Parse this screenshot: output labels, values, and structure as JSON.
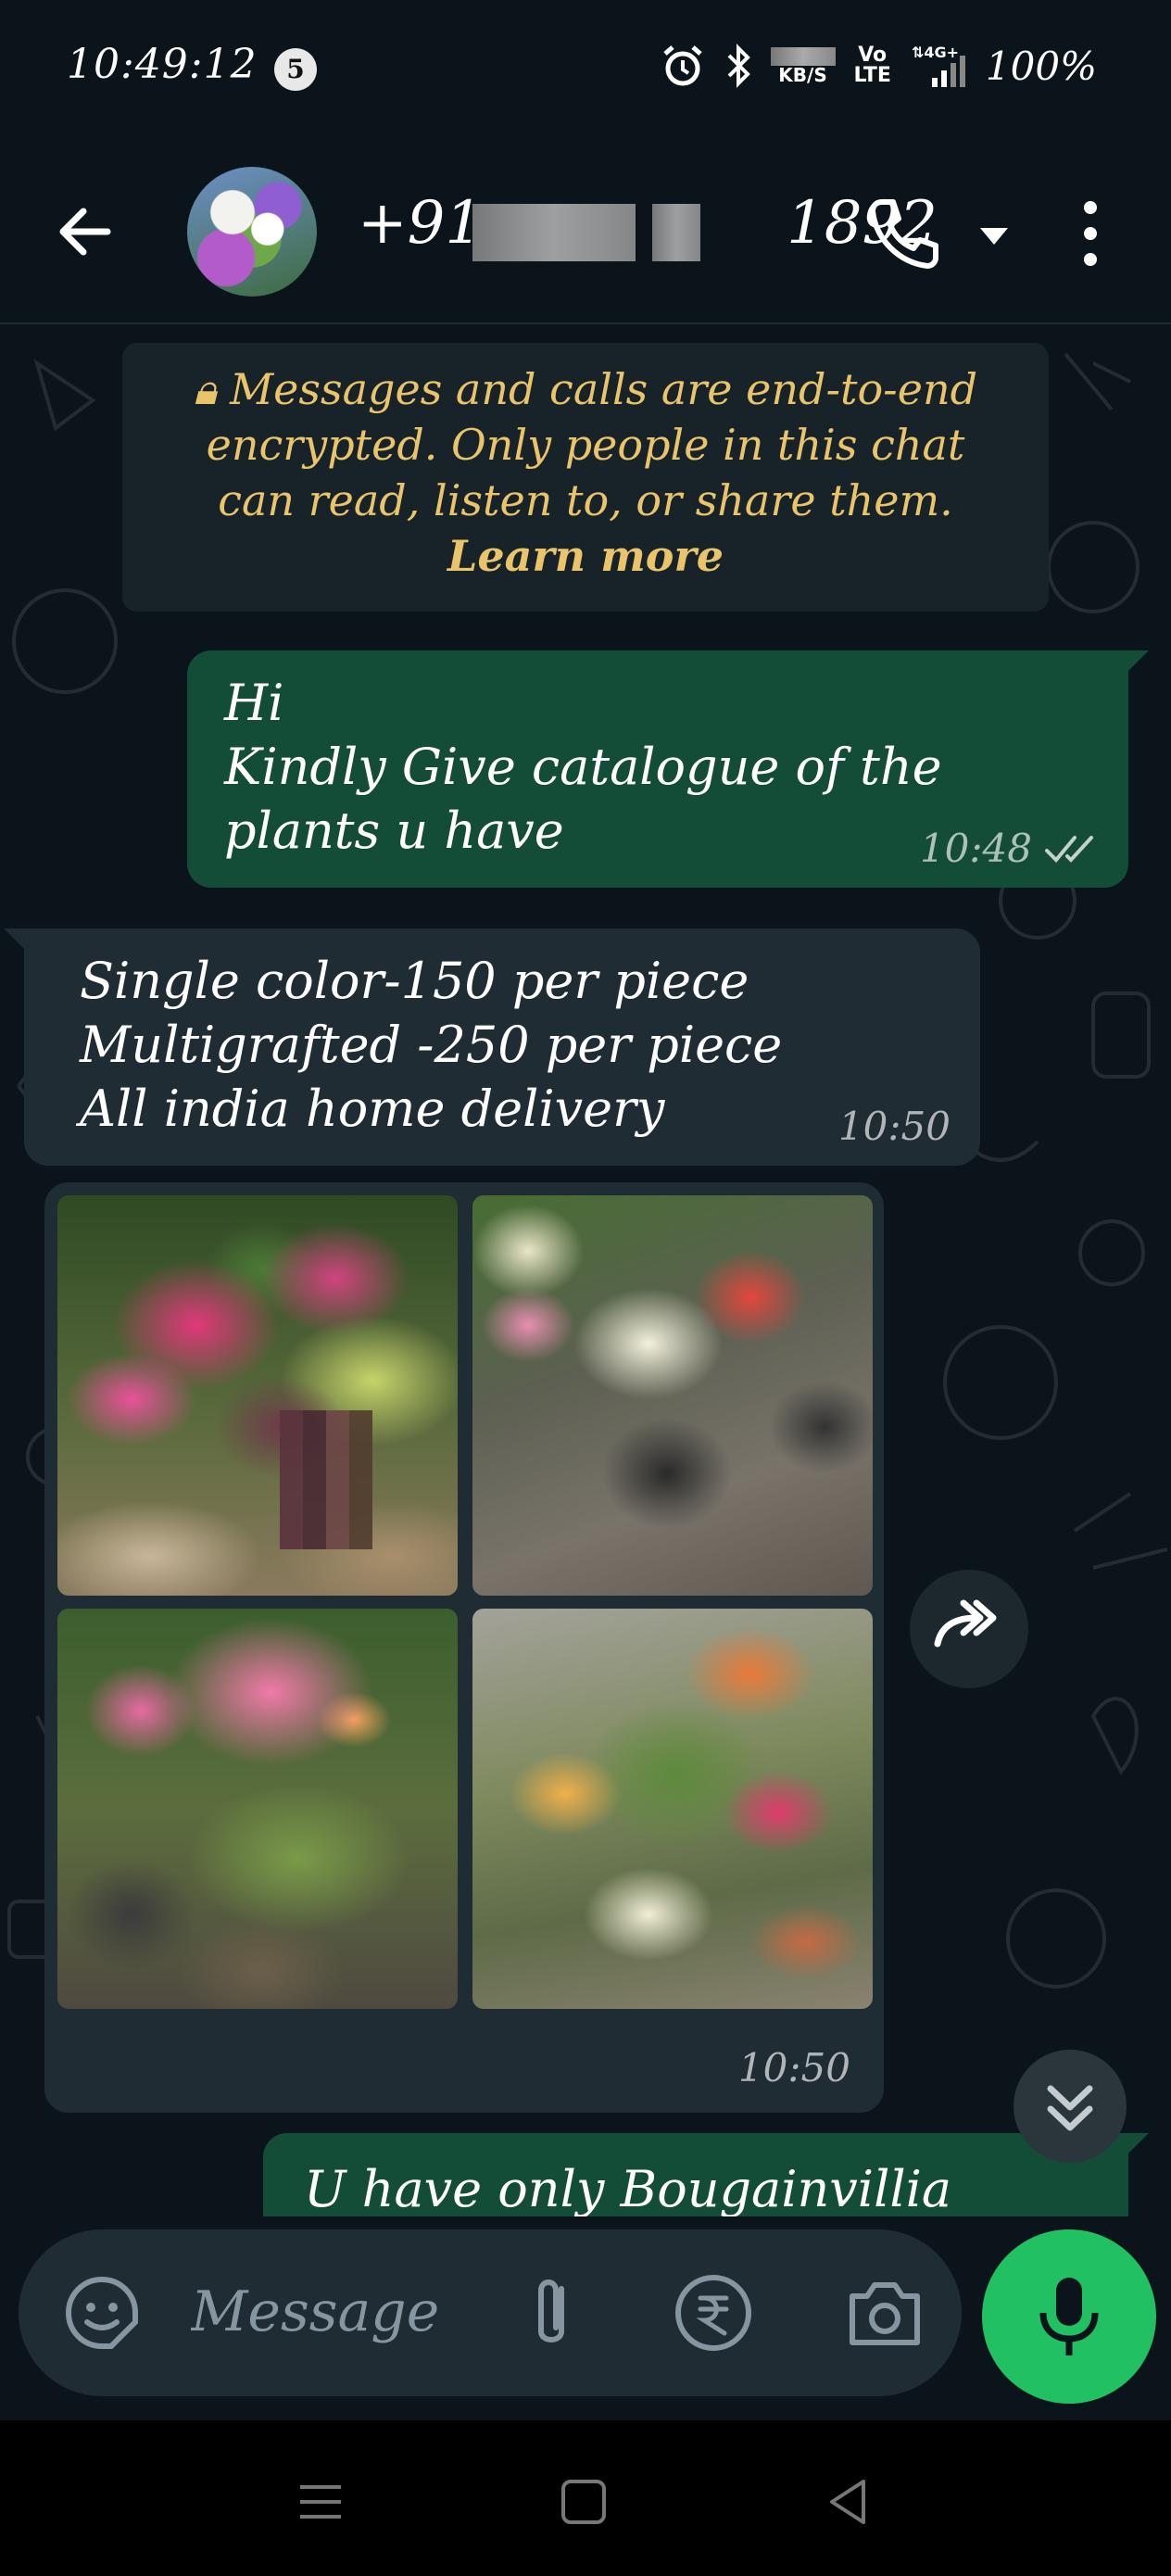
{
  "status_bar": {
    "time": "10:49:12",
    "notification_count": "5",
    "net_speed_value": "KB/S",
    "volte_top": "Vo",
    "volte_bottom": "LTE",
    "network": "4G+",
    "battery": "100%"
  },
  "header": {
    "contact_prefix": "+91",
    "contact_suffix": "1892"
  },
  "encryption_notice": {
    "text": "Messages and calls are end-to-end encrypted. Only people in this chat can read, listen to, or share them.",
    "link": "Learn more"
  },
  "messages": [
    {
      "direction": "outgoing",
      "text": "Hi\nKindly Give catalogue of the plants u have",
      "time": "10:48",
      "status": "read"
    },
    {
      "direction": "incoming",
      "text": "Single color-150 per piece\nMultigrafted -250  per piece\nAll india home delivery",
      "time": "10:50"
    },
    {
      "direction": "incoming",
      "type": "photo-album",
      "photo_count": 4,
      "time": "10:50"
    },
    {
      "direction": "outgoing",
      "text": "U have only Bougainvillia plant?"
    }
  ],
  "input_bar": {
    "placeholder": "Message"
  },
  "colors": {
    "background": "#0b141a",
    "outgoing_bubble": "#144d37",
    "incoming_bubble": "#202c33",
    "notice_text": "#e9c46a",
    "accent": "#21c063"
  },
  "icons": {
    "back": "arrow-left-icon",
    "call": "phone-icon",
    "caret": "caret-down-icon",
    "menu": "more-vertical-icon",
    "lock": "lock-icon",
    "read_receipt": "double-check-icon",
    "forward": "forward-icon",
    "scroll": "chevron-double-down-icon",
    "emoji": "sticker-icon",
    "attach": "paperclip-icon",
    "payment": "rupee-icon",
    "camera": "camera-icon",
    "mic": "microphone-icon"
  }
}
